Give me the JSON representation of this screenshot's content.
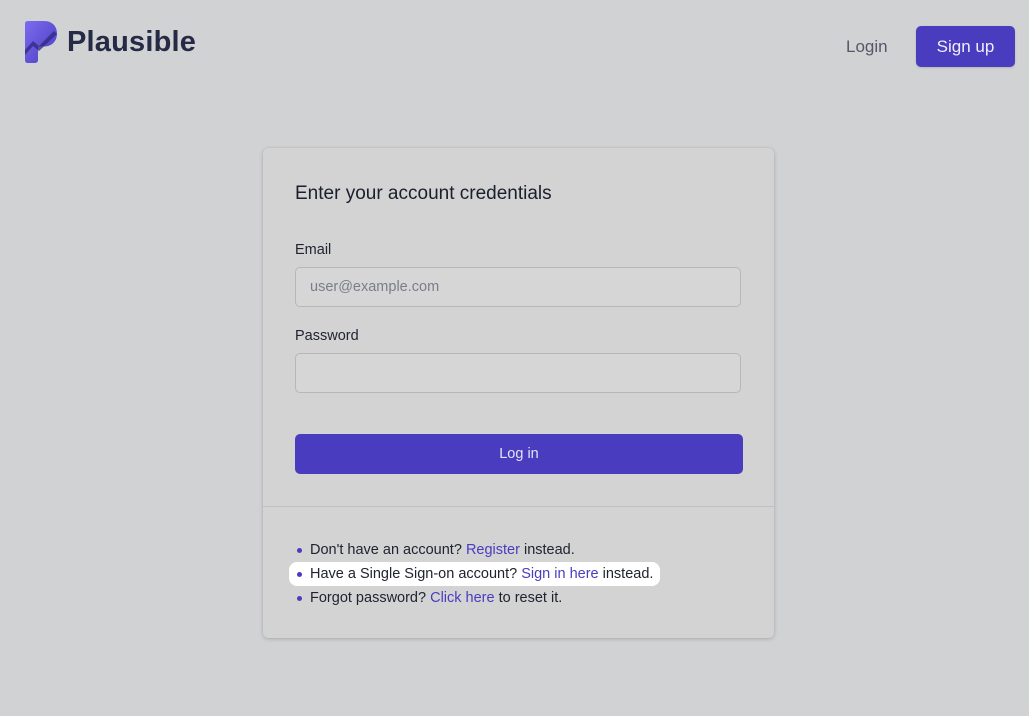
{
  "header": {
    "brand": "Plausible",
    "login_label": "Login",
    "signup_label": "Sign up"
  },
  "form": {
    "title": "Enter your account credentials",
    "email_label": "Email",
    "email_placeholder": "user@example.com",
    "email_value": "",
    "password_label": "Password",
    "password_value": "",
    "submit_label": "Log in"
  },
  "links": [
    {
      "before": "Don't have an account?",
      "link": "Register",
      "after": "instead."
    },
    {
      "before": "Have a Single Sign-on account?",
      "link": "Sign in here",
      "after": "instead."
    },
    {
      "before": "Forgot password?",
      "link": "Click here",
      "after": "to reset it."
    }
  ],
  "colors": {
    "accent": "#4a3cbe",
    "background": "#d1d2d4",
    "highlight": "#ffffff"
  },
  "icons": {
    "logo": "plausible-logo-icon"
  }
}
